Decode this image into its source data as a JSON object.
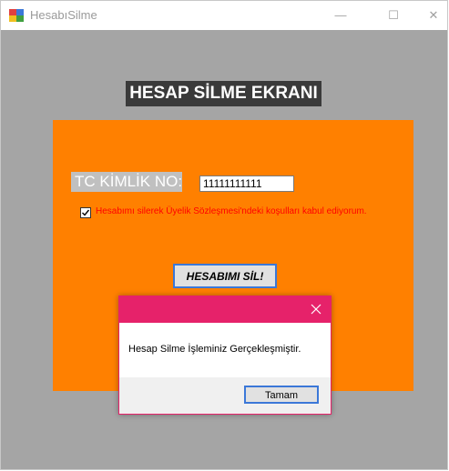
{
  "window": {
    "title": "HesabıSilme",
    "minimize_glyph": "—",
    "maximize_glyph": "☐",
    "close_glyph": "✕"
  },
  "form": {
    "heading": "HESAP SİLME EKRANI",
    "tc_label": "TC KİMLİK NO:",
    "tc_value": "11111111111",
    "consent_checked": true,
    "consent_text": "Hesabımı silerek Üyelik Sözleşmesi'ndeki koşulları kabul ediyorum.",
    "delete_button": "HESABIMI SİL!"
  },
  "dialog": {
    "message": "Hesap Silme İşleminiz Gerçekleşmiştir.",
    "ok_button": "Tamam"
  },
  "colors": {
    "form_background": "#a5a5a5",
    "panel": "#ff8000",
    "heading_bg": "#3a3a3a",
    "consent_text": "#ff0000",
    "dialog_accent": "#e6226a",
    "button_focus_border": "#3b78d8"
  }
}
